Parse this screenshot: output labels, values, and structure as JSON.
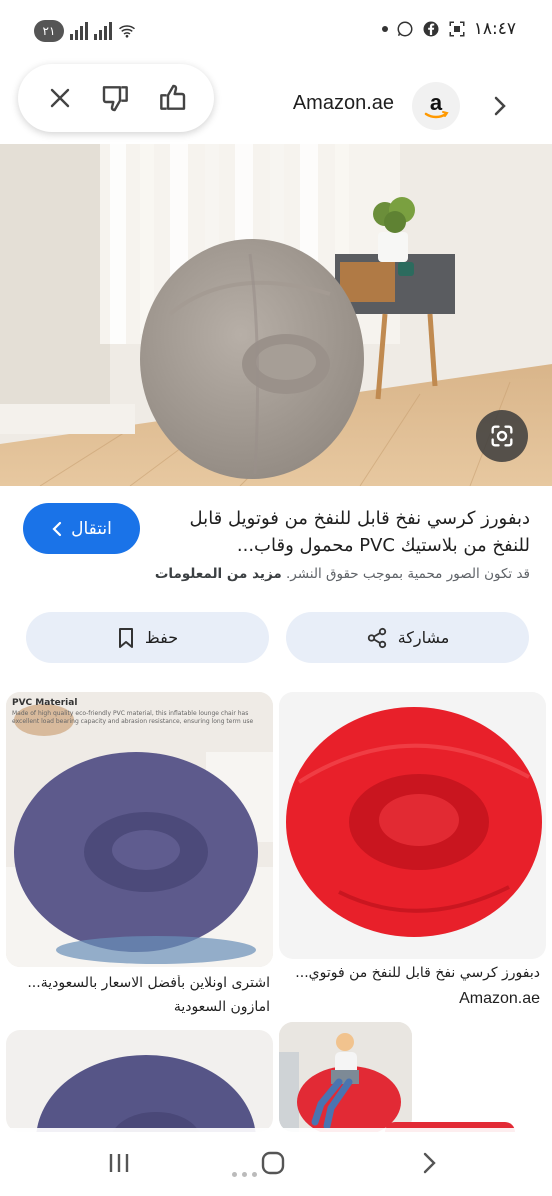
{
  "status_bar": {
    "time": "١٨:٤٧",
    "badge": "٢١",
    "icons": [
      "notification-dot",
      "whatsapp-icon",
      "facebook-icon",
      "screenshot-icon",
      "signal-icon",
      "signal-icon",
      "wifi-icon"
    ]
  },
  "header": {
    "site_name": "Amazon.ae",
    "logo_letter": "a",
    "icons": [
      "close-icon",
      "thumbs-down-icon",
      "thumbs-up-icon",
      "chevron-right-icon"
    ]
  },
  "hero": {
    "lens_icon": "google-lens-icon"
  },
  "result": {
    "title": "دبفورز كرسي نفخ قابل للنفخ من فوتويل قابل للنفخ من بلاستيك PVC محمول وقاب...",
    "visit_label": "انتقال",
    "copyright_text": "قد تكون الصور محمية بموجب حقوق النشر.",
    "more_info_label": "مزيد من المعلومات",
    "share_label": "مشاركة",
    "save_label": "حفظ"
  },
  "grid": {
    "items": [
      {
        "caption": "دبفورز كرسي نفخ قابل للنفخ من فوتوي...",
        "source": "Amazon.ae",
        "color": "#e8202a"
      },
      {
        "caption": "اشترى اونلاين بأفضل الاسعار بالسعودية...",
        "source": "امازون السعودية",
        "overlay_title": "PVC Material",
        "overlay_text": "Made of high quality eco-friendly PVC material, this inflatable lounge chair has excellent load bearing capacity and abrasion resistance, ensuring long term use",
        "color": "#5d5a8c"
      },
      {
        "caption": "",
        "source": "",
        "color": "#e22a35"
      },
      {
        "caption": "",
        "source": "",
        "color": "#565587"
      }
    ]
  },
  "colors": {
    "accent": "#1a73e8",
    "action_bg": "#e8eef8",
    "chair_gray": "#a89f97"
  },
  "navbar": {
    "icons": [
      "recent-apps-icon",
      "home-icon",
      "back-icon"
    ]
  }
}
